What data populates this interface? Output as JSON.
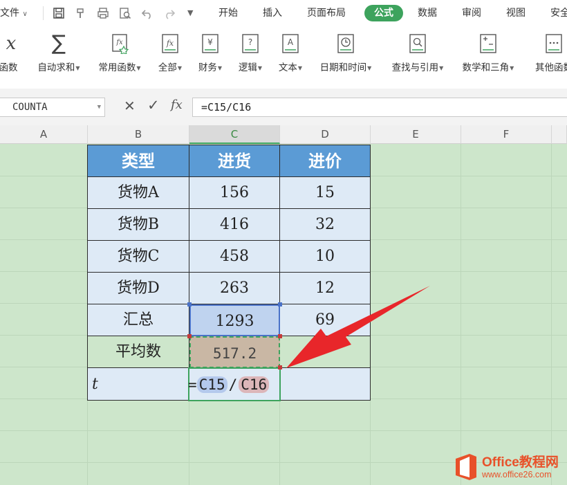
{
  "menubar": {
    "file": "文件",
    "tabs": [
      "开始",
      "插入",
      "页面布局",
      "公式",
      "数据",
      "审阅",
      "视图",
      "安全"
    ],
    "active_tab": "公式",
    "accent_color": "#3da35d"
  },
  "ribbon": {
    "buttons": [
      "函数",
      "自动求和",
      "常用函数",
      "全部",
      "财务",
      "逻辑",
      "文本",
      "日期和时间",
      "查找与引用",
      "数学和三角",
      "其他函数"
    ]
  },
  "formula_bar": {
    "name_box": "COUNTA",
    "cancel_icon": "✕",
    "confirm_icon": "✓",
    "fx_label": "fx",
    "formula": "=C15/C16"
  },
  "columns": [
    "A",
    "B",
    "C",
    "D",
    "E",
    "F"
  ],
  "table": {
    "headers": [
      "类型",
      "进货",
      "进价"
    ],
    "rows": [
      [
        "货物A",
        "156",
        "15"
      ],
      [
        "货物B",
        "416",
        "32"
      ],
      [
        "货物C",
        "458",
        "10"
      ],
      [
        "货物D",
        "263",
        "12"
      ],
      [
        "汇总",
        "1293",
        "69"
      ],
      [
        "平均数",
        "517.2",
        ""
      ]
    ],
    "edit_row": {
      "b": "t",
      "eq": "=",
      "ref1": "C15",
      "slash": "/",
      "ref2": "C16"
    }
  },
  "watermark": {
    "brand": "Office教程网",
    "url": "www.office26.com"
  }
}
